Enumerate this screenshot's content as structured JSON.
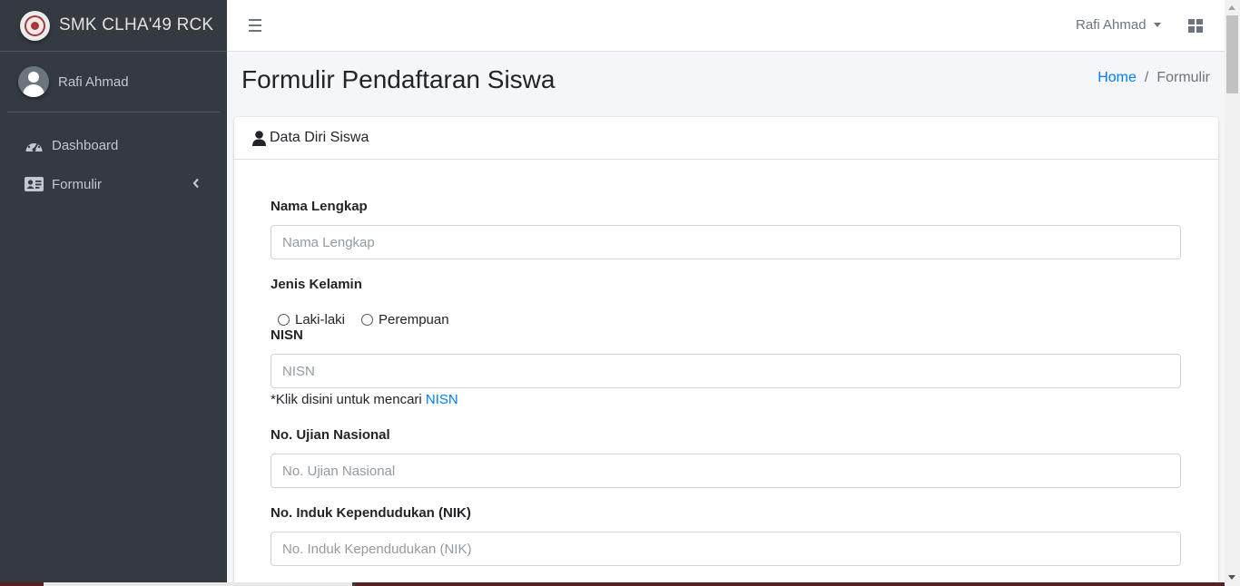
{
  "sidebar": {
    "brand": "SMK CLHA'49 RCK",
    "user_name": "Rafi Ahmad",
    "items": [
      {
        "label": "Dashboard",
        "icon": "tachometer-icon"
      },
      {
        "label": "Formulir",
        "icon": "id-card-icon"
      }
    ]
  },
  "topbar": {
    "user_menu": "Rafi Ahmad"
  },
  "header": {
    "title": "Formulir Pendaftaran Siswa",
    "breadcrumb": [
      "Home",
      "Formulir"
    ]
  },
  "card": {
    "title": "Data Diri Siswa"
  },
  "form": {
    "nama_label": "Nama Lengkap",
    "nama_placeholder": "Nama Lengkap",
    "gender_label": "Jenis Kelamin",
    "gender_options": [
      "Laki-laki",
      "Perempuan"
    ],
    "nisn_label": "NISN",
    "nisn_placeholder": "NISN",
    "nisn_note": "*Klik disini untuk mencari ",
    "nisn_note_link": "NISN",
    "ujian_label": "No. Ujian Nasional",
    "ujian_placeholder": "No. Ujian Nasional",
    "nik_label": "No. Induk Kependudukan (NIK)",
    "nik_placeholder": "No. Induk Kependudukan (NIK)"
  },
  "colors": {
    "sidebar_bg": "#343a40",
    "link": "#007bff",
    "content_bg": "#f4f6f9"
  }
}
